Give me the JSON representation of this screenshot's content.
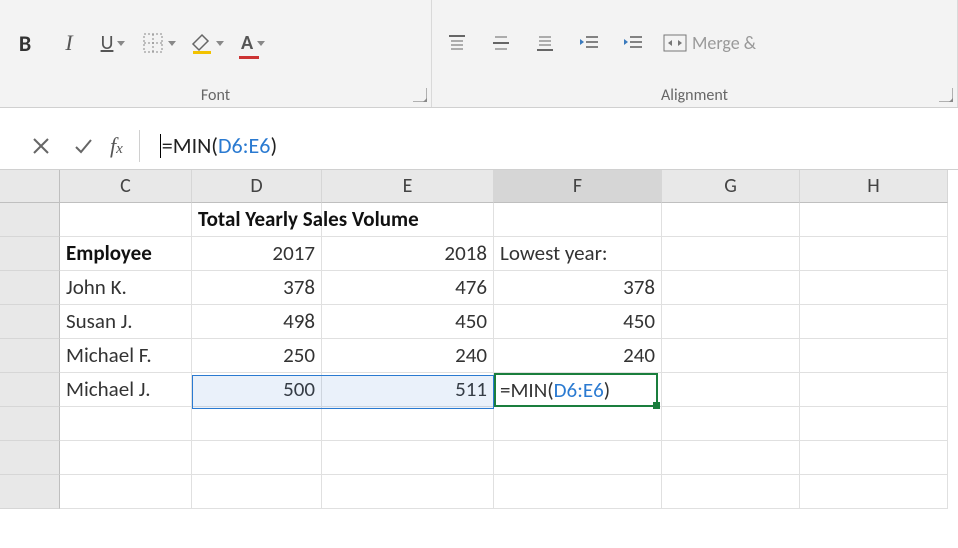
{
  "ribbon": {
    "font_label": "Font",
    "alignment_label": "Alignment",
    "merge_label": "Merge & "
  },
  "formula": {
    "prefix": "=MIN(",
    "ref": "D6:E6",
    "suffix": ")"
  },
  "columns": [
    "C",
    "D",
    "E",
    "F",
    "G",
    "H"
  ],
  "active_column": "F",
  "rows": [
    {
      "c": "",
      "d": "Total Yearly Sales Volume",
      "e": "",
      "f": "",
      "bold_d": true
    },
    {
      "c": "Employee",
      "d": "2017",
      "e": "2018",
      "f": "Lowest year:",
      "bold_c": true
    },
    {
      "c": "John K.",
      "d": "378",
      "e": "476",
      "f": "378"
    },
    {
      "c": "Susan J.",
      "d": "498",
      "e": "450",
      "f": "450"
    },
    {
      "c": "Michael F.",
      "d": "250",
      "e": "240",
      "f": "240"
    },
    {
      "c": "Michael J.",
      "d": "500",
      "e": "511",
      "f_edit_prefix": "=MIN(",
      "f_edit_ref": "D6:E6",
      "f_edit_suffix": ")"
    }
  ]
}
